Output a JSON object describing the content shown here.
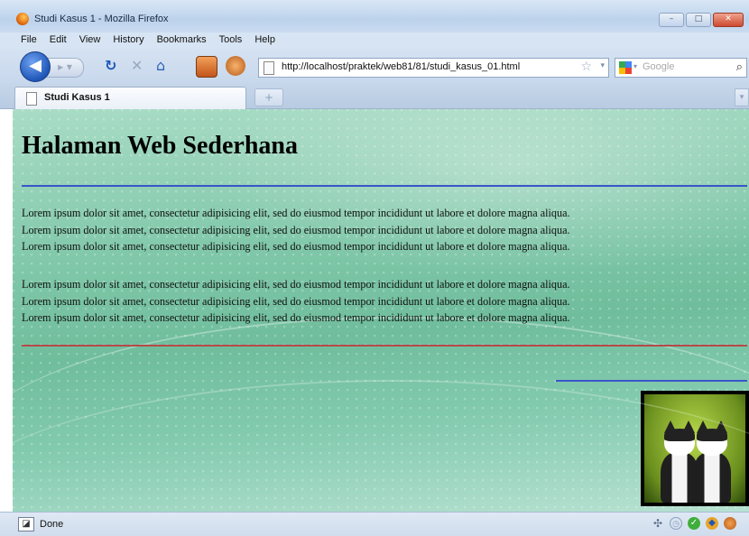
{
  "window": {
    "title": "Studi Kasus 1 - Mozilla Firefox",
    "controls": {
      "minimize": "–",
      "maximize": "□",
      "close": "✕"
    }
  },
  "menubar": {
    "items": [
      "File",
      "Edit",
      "View",
      "History",
      "Bookmarks",
      "Tools",
      "Help"
    ]
  },
  "navbar": {
    "url": "http://localhost/praktek/web81/81/studi_kasus_01.html",
    "search_placeholder": "Google",
    "icons": [
      "back-icon",
      "forward-icon",
      "reload-icon",
      "stop-icon",
      "home-icon",
      "addon-icon",
      "addon-icon",
      "star-icon",
      "google-icon",
      "magnifier-icon"
    ]
  },
  "tabs": [
    {
      "label": "Studi Kasus 1",
      "active": true
    }
  ],
  "page": {
    "heading": "Halaman Web Sederhana",
    "paragraphs": [
      [
        "Lorem ipsum dolor sit amet, consectetur adipisicing elit, sed do eiusmod tempor incididunt ut labore et dolore magna aliqua.",
        "Lorem ipsum dolor sit amet, consectetur adipisicing elit, sed do eiusmod tempor incididunt ut labore et dolore magna aliqua.",
        "Lorem ipsum dolor sit amet, consectetur adipisicing elit, sed do eiusmod tempor incididunt ut labore et dolore magna aliqua."
      ],
      [
        "Lorem ipsum dolor sit amet, consectetur adipisicing elit, sed do eiusmod tempor incididunt ut labore et dolore magna aliqua.",
        "Lorem ipsum dolor sit amet, consectetur adipisicing elit, sed do eiusmod tempor incididunt ut labore et dolore magna aliqua.",
        "Lorem ipsum dolor sit amet, consectetur adipisicing elit, sed do eiusmod tempor incididunt ut labore et dolore magna aliqua."
      ]
    ],
    "colors": {
      "hr_blue": "#3a55c8",
      "hr_red": "#b44a4a",
      "background": "#7fc7a8"
    }
  },
  "statusbar": {
    "text": "Done"
  }
}
